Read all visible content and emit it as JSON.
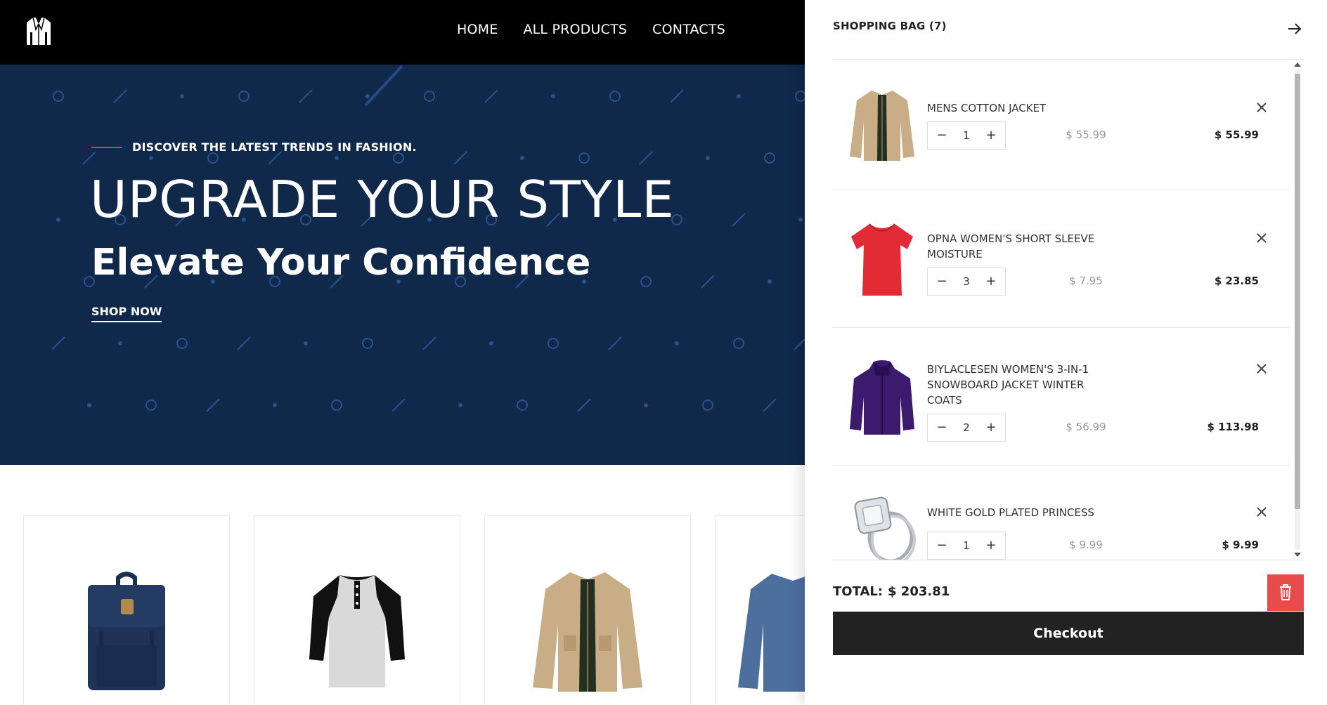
{
  "header": {
    "logo": "suit-logo-icon",
    "nav": [
      "HOME",
      "ALL PRODUCTS",
      "CONTACTS"
    ]
  },
  "hero": {
    "kicker": "DISCOVER THE LATEST TRENDS IN FASHION.",
    "title": "UPGRADE YOUR STYLE",
    "subtitle": "Elevate Your Confidence",
    "cta": "SHOP NOW",
    "background_color": "#10284a",
    "accent_color": "#e63b40"
  },
  "products": [
    {
      "image": "navy-backpack-icon"
    },
    {
      "image": "raglan-henley-shirt-icon"
    },
    {
      "image": "khaki-jacket-icon"
    },
    {
      "image": "blue-shirt-icon"
    }
  ],
  "cart": {
    "title": "SHOPPING BAG (7)",
    "close_icon": "arrow-right-icon",
    "items": [
      {
        "name": "MENS COTTON JACKET",
        "qty": "1",
        "unit_price": "$ 55.99",
        "total": "$ 55.99",
        "image": "khaki-jacket-icon"
      },
      {
        "name": "OPNA WOMEN'S SHORT SLEEVE MOISTURE",
        "qty": "3",
        "unit_price": "$ 7.95",
        "total": "$ 23.85",
        "image": "red-tshirt-icon"
      },
      {
        "name": "BIYLACLESEN WOMEN'S 3-IN-1 SNOWBOARD JACKET WINTER COATS",
        "qty": "2",
        "unit_price": "$ 56.99",
        "total": "$ 113.98",
        "image": "purple-jacket-icon"
      },
      {
        "name": "WHITE GOLD PLATED PRINCESS",
        "qty": "1",
        "unit_price": "$ 9.99",
        "total": "$ 9.99",
        "image": "diamond-ring-icon"
      }
    ],
    "minus": "−",
    "plus": "+",
    "total_label": "TOTAL:",
    "total_value": "$ 203.81",
    "checkout_label": "Checkout",
    "clear_icon": "trash-icon",
    "clear_color": "#e94a4a"
  }
}
